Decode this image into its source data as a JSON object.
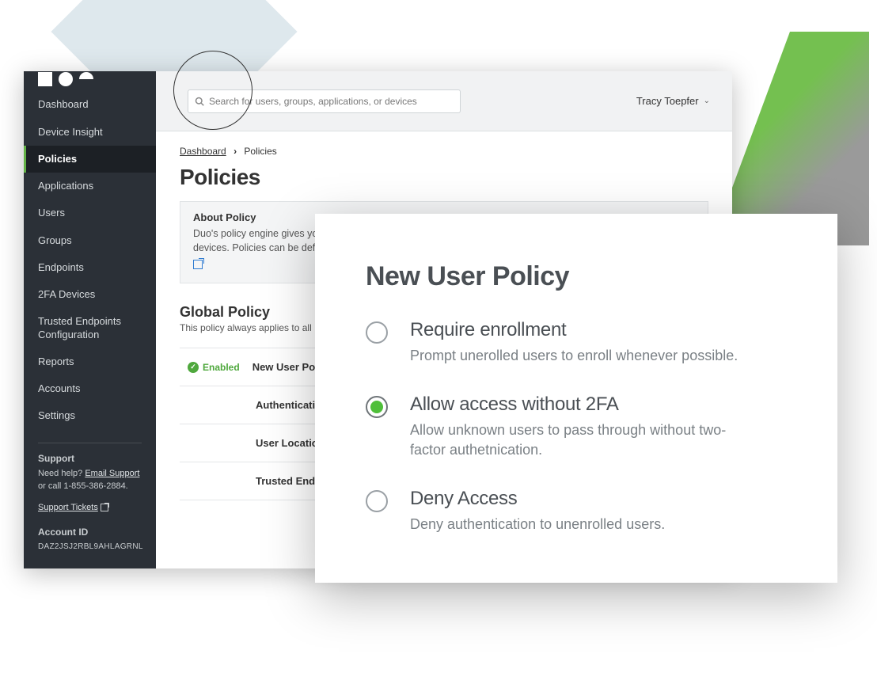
{
  "sidebar": {
    "items": [
      {
        "label": "Dashboard"
      },
      {
        "label": "Device Insight"
      },
      {
        "label": "Policies"
      },
      {
        "label": "Applications"
      },
      {
        "label": "Users"
      },
      {
        "label": "Groups"
      },
      {
        "label": "Endpoints"
      },
      {
        "label": "2FA Devices"
      },
      {
        "label": "Trusted Endpoints Configuration"
      },
      {
        "label": "Reports"
      },
      {
        "label": "Accounts"
      },
      {
        "label": "Settings"
      }
    ],
    "active_index": 2
  },
  "support": {
    "header": "Support",
    "need": "Need help? ",
    "email_link": "Email Support",
    "or_call": "or call 1-855-386-2884.",
    "tickets": "Support Tickets",
    "account_id_label": "Account ID",
    "account_id": "DAZ2JSJ2RBL9AHLAGRNL"
  },
  "topbar": {
    "search_placeholder": "Search for users, groups, applications, or devices",
    "user": "Tracy Toepfer"
  },
  "breadcrumb": {
    "root": "Dashboard",
    "current": "Policies"
  },
  "page": {
    "title": "Policies",
    "about_header": "About Policy",
    "about_text": "Duo's policy engine gives you the ability to control how your users authenticate, from where, using which types of devices. Policies can be defined",
    "section_title": "Global Policy",
    "section_desc": "This policy always applies to all",
    "enabled": "Enabled",
    "rows": [
      {
        "label": "New User Policies"
      },
      {
        "label": "Authentication"
      },
      {
        "label": "User Location"
      },
      {
        "label": "Trusted Endpo"
      }
    ]
  },
  "modal": {
    "title": "New User Policy",
    "options": [
      {
        "title": "Require enrollment",
        "desc": "Prompt unerolled users to enroll whenever possible."
      },
      {
        "title": "Allow access without 2FA",
        "desc": "Allow unknown users to pass through without two-factor authetnication."
      },
      {
        "title": "Deny Access",
        "desc": "Deny authentication to unenrolled users."
      }
    ],
    "selected_index": 1
  }
}
